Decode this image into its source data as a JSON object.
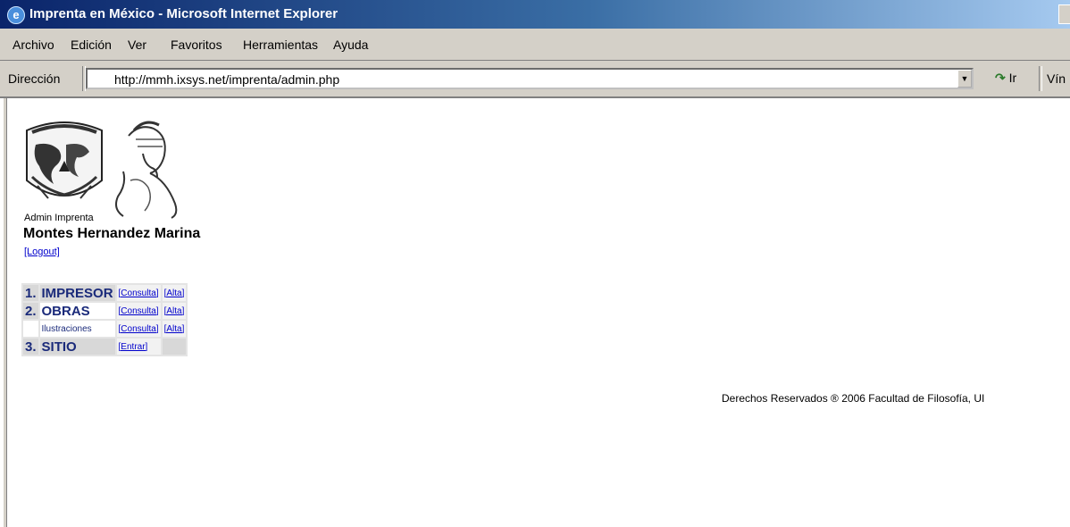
{
  "window": {
    "title": "Imprenta en México - Microsoft Internet Explorer"
  },
  "menu": {
    "items": [
      "Archivo",
      "Edición",
      "Ver",
      "Favoritos",
      "Herramientas",
      "Ayuda"
    ]
  },
  "address_bar": {
    "label": "Dirección",
    "url": "http://mmh.ixsys.net/imprenta/admin.php",
    "go_label": "Ir",
    "links_label": "Vín"
  },
  "page": {
    "admin_label": "Admin Imprenta",
    "admin_name": "Montes Hernandez Marina",
    "logout": "[Logout]",
    "menu_rows": [
      {
        "num": "1.",
        "section": "IMPRESOR",
        "link1": "[Consulta]",
        "link2": "[Alta]"
      },
      {
        "num": "2.",
        "section": "OBRAS",
        "link1": "[Consulta]",
        "link2": "[Alta]"
      },
      {
        "num": "",
        "section": "Ilustraciones",
        "link1": "[Consulta]",
        "link2": "[Alta]"
      },
      {
        "num": "3.",
        "section": "SITIO",
        "link1": "[Entrar]",
        "link2": ""
      }
    ],
    "footer": "Derechos Reservados ® 2006 Facultad de Filosofía, UI"
  },
  "colors": {
    "titlebar": "#0a246a",
    "chrome": "#d4d0c8",
    "menu_text": "#1a2a7a",
    "link": "#0000cc"
  }
}
